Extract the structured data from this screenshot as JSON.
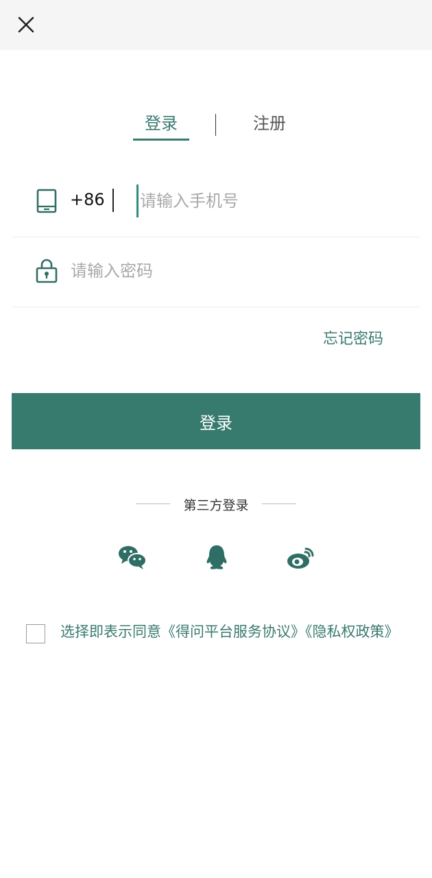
{
  "header": {
    "close_icon": "close-icon"
  },
  "tabs": {
    "login_label": "登录",
    "register_label": "注册",
    "active": "login"
  },
  "form": {
    "phone": {
      "icon": "phone-icon",
      "country_code": "+86",
      "placeholder": "请输入手机号",
      "value": ""
    },
    "password": {
      "icon": "lock-icon",
      "placeholder": "请输入密码",
      "value": ""
    },
    "forgot_label": "忘记密码",
    "submit_label": "登录"
  },
  "third_party": {
    "title": "第三方登录",
    "providers": [
      "wechat-icon",
      "qq-icon",
      "weibo-icon"
    ]
  },
  "agreement": {
    "checked": false,
    "prefix": "选择即表示同意",
    "service_link": "《得问平台服务协议》",
    "privacy_link": "《隐私权政策》"
  },
  "colors": {
    "accent": "#377a6e",
    "accent_text": "#3a7a70",
    "topbar_bg": "#f5f5f5"
  }
}
